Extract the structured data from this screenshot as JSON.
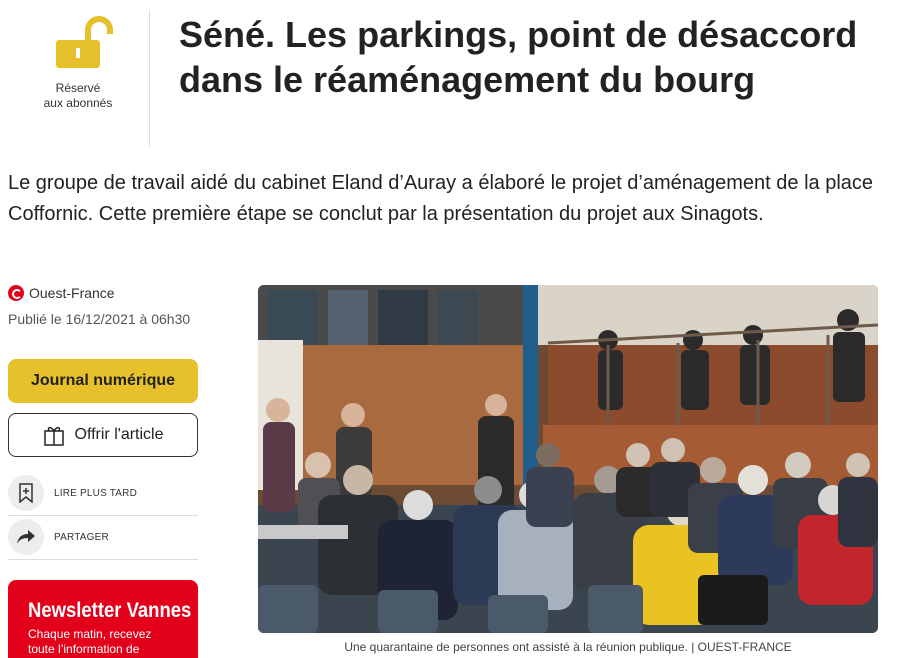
{
  "badge": {
    "label_line1": "Réservé",
    "label_line2": "aux abonnés",
    "icon": "unlocked-padlock-icon",
    "color": "#e6c12b"
  },
  "article": {
    "title": "Séné. Les parkings, point de désaccord dans le réaménagement du bourg",
    "lead": "Le groupe de travail aidé du cabinet Eland d’Auray a élaboré le projet d’aménagement de la place Coffornic. Cette première étape se conclut par la présentation du projet aux Sinagots.",
    "source": "Ouest-France",
    "date": "Publié le 16/12/2021 à 06h30"
  },
  "buttons": {
    "journal": "Journal numérique",
    "offer": "Offrir l'article",
    "read_later": "LIRE PLUS TARD",
    "share": "PARTAGER"
  },
  "newsletter": {
    "title": "Newsletter Vannes",
    "text_line1": "Chaque matin, recevez",
    "text_line2": "toute l’information de"
  },
  "photo": {
    "caption": "Une quarantaine de personnes ont assisté à la réunion publique. | OUEST-FRANCE"
  },
  "colors": {
    "brand_red": "#e2001a",
    "accent_yellow": "#e6c12b"
  }
}
